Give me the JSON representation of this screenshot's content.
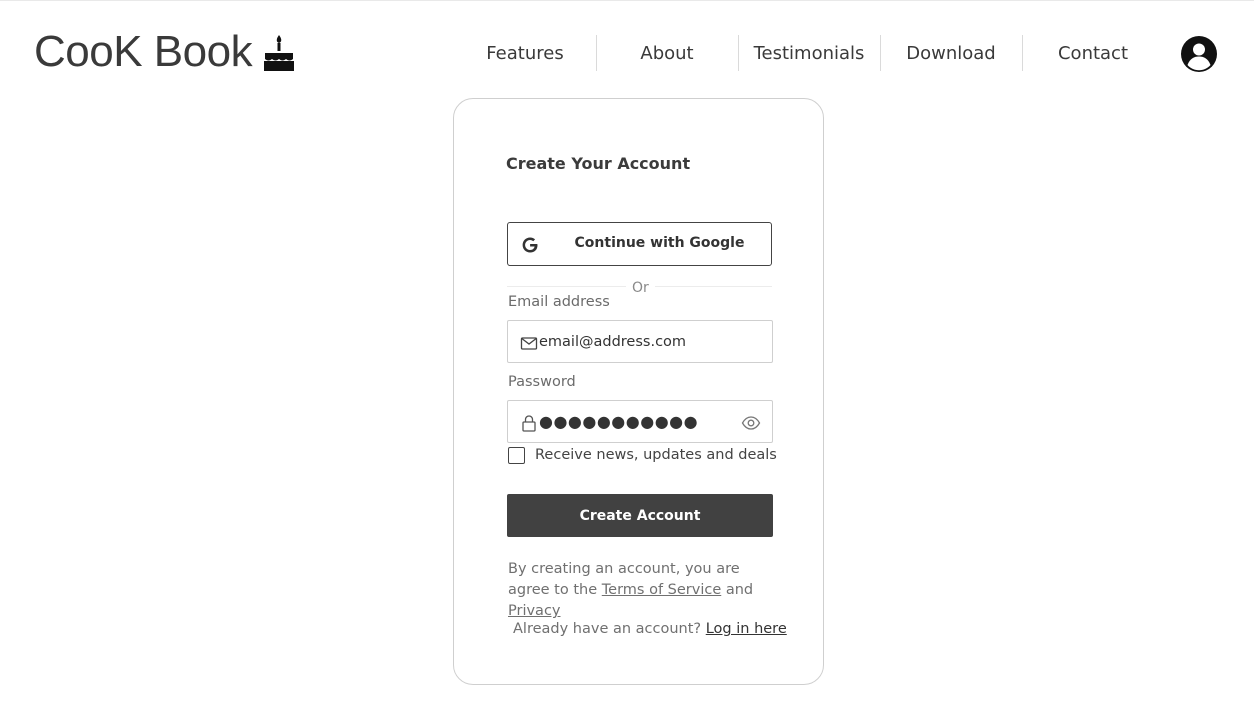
{
  "header": {
    "logo_text": "CooK Book",
    "logo_icon": "birthday-cake-icon",
    "nav": [
      {
        "label": "Features"
      },
      {
        "label": "About"
      },
      {
        "label": "Testimonials"
      },
      {
        "label": "Download"
      },
      {
        "label": "Contact"
      }
    ],
    "account_icon": "user-circle-icon"
  },
  "signup_card": {
    "title": "Create Your Account",
    "google_button_label": "Continue with Google",
    "divider_text": "Or",
    "email": {
      "label": "Email address",
      "value": "email@address.com",
      "icon": "envelope-icon"
    },
    "password": {
      "label": "Password",
      "masked_value": "●●●●●●●●●●●",
      "icon": "lock-icon",
      "toggle_icon": "eye-icon"
    },
    "newsletter_checkbox": {
      "label": "Receive news, updates and deals",
      "checked": false
    },
    "create_button_label": "Create Account",
    "terms": {
      "prefix": "By creating an account, you are agree to the",
      "terms_link": "Terms of Service",
      "conjunction": "and",
      "privacy_link": "Privacy "
    },
    "login_prompt": {
      "text": "Already have an account?",
      "link": "Log in here"
    }
  },
  "colors": {
    "primary_button": "#414141",
    "border": "#cfcfcf",
    "text_dark": "#333333",
    "text_muted": "#707070"
  }
}
